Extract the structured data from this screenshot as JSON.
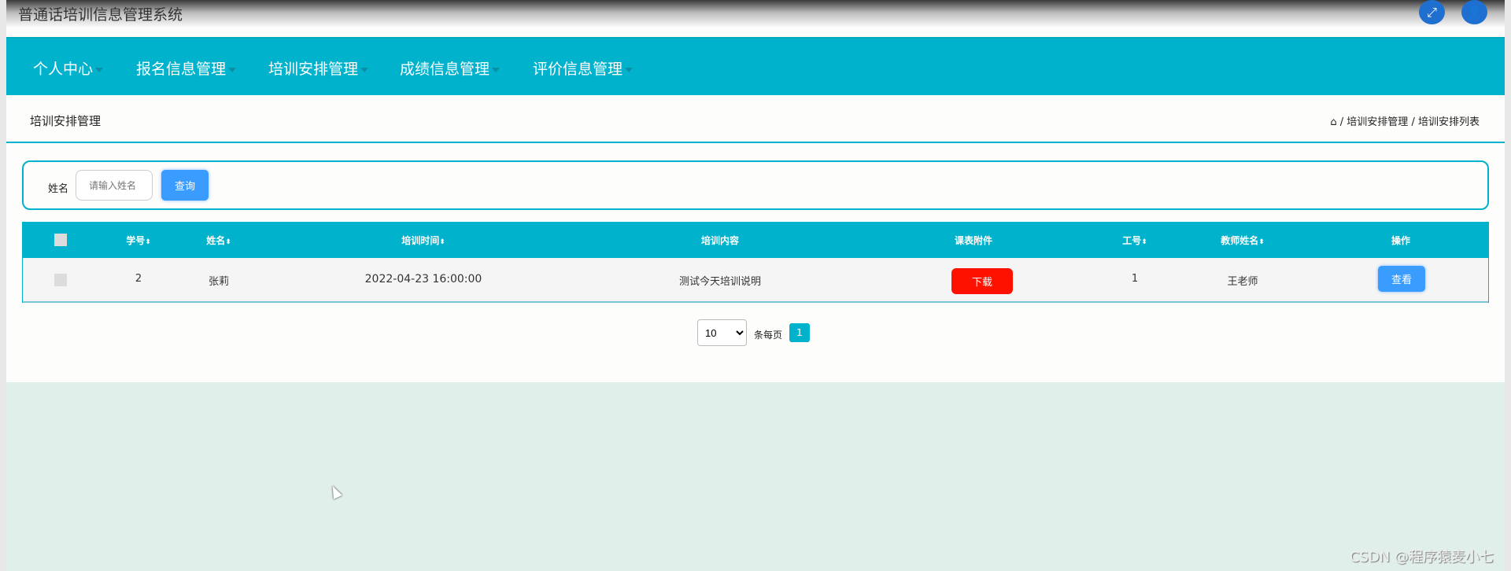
{
  "header": {
    "title": "普通话培训信息管理系统",
    "icons": [
      "fullscreen-icon",
      "user-icon"
    ]
  },
  "nav": {
    "items": [
      {
        "label": "个人中心"
      },
      {
        "label": "报名信息管理"
      },
      {
        "label": "培训安排管理"
      },
      {
        "label": "成绩信息管理"
      },
      {
        "label": "评价信息管理"
      }
    ]
  },
  "breadcrumb": {
    "title": "培训安排管理",
    "path": [
      "培训安排管理",
      "培训安排列表"
    ],
    "sep": "/"
  },
  "search": {
    "label": "姓名",
    "placeholder": "请输入姓名",
    "button": "查询"
  },
  "table": {
    "headers": [
      "学号",
      "姓名",
      "培训时间",
      "培训内容",
      "课表附件",
      "工号",
      "教师姓名",
      "操作"
    ],
    "sort_mark": "⬍",
    "rows": [
      {
        "xuehao": "2",
        "name": "张莉",
        "time": "2022-04-23 16:00:00",
        "content": "测试今天培训说明",
        "attachment": "下载",
        "gonghao": "1",
        "teacher": "王老师",
        "action": "查看"
      }
    ]
  },
  "pagination": {
    "page_size": "10",
    "per_page_label": "条每页",
    "current_page": "1"
  },
  "watermark": "CSDN @程序猿麦小七",
  "colors": {
    "accent": "#00b2cc",
    "primary_button": "#3b9cff",
    "download_button": "#ff1100"
  }
}
